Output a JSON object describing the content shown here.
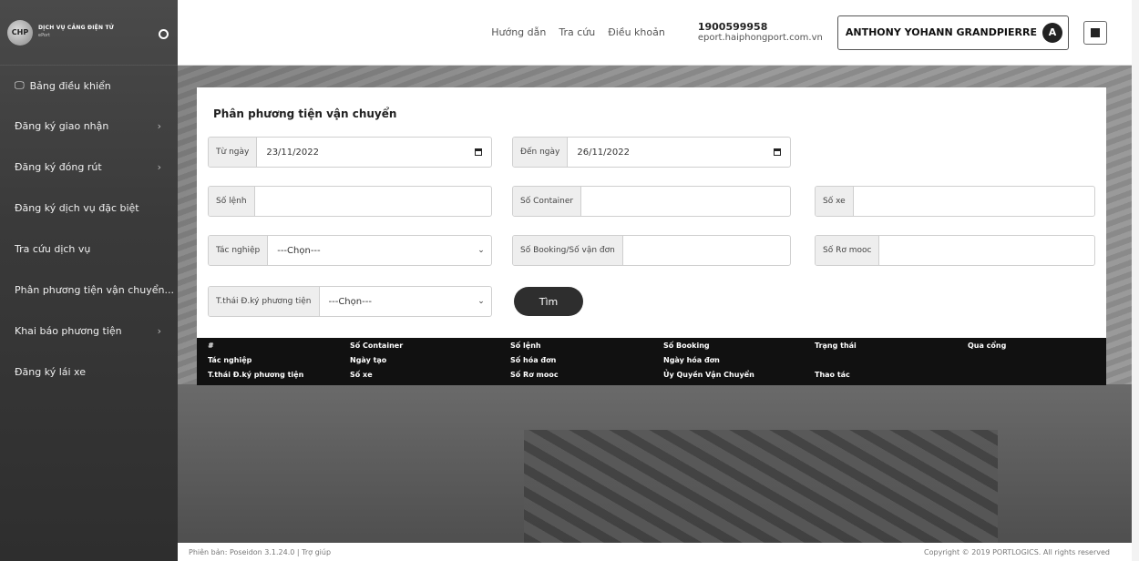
{
  "brand": {
    "logo_text": "CHP",
    "title": "DỊCH VỤ CẢNG ĐIỆN TỬ",
    "subtitle": "ePort"
  },
  "sidebar": {
    "items": [
      {
        "label": "Bảng điều khiển",
        "icon": "monitor-icon"
      },
      {
        "label": "Đăng ký giao nhận",
        "has_submenu": true
      },
      {
        "label": "Đăng ký đóng rút",
        "has_submenu": true
      },
      {
        "label": "Đăng ký dịch vụ đặc biệt"
      },
      {
        "label": "Tra cứu dịch vụ"
      },
      {
        "label": "Phân phương tiện vận chuyển..."
      },
      {
        "label": "Khai báo phương tiện",
        "has_submenu": true
      },
      {
        "label": "Đăng ký lái xe"
      }
    ],
    "chevron": "›"
  },
  "header": {
    "links": [
      "Hướng dẫn",
      "Tra cứu",
      "Điều khoản"
    ],
    "hotline": "1900599958",
    "email": "eport.haiphongport.com.vn",
    "user_name": "ANTHONY YOHANN GRANDPIERRE",
    "avatar_letter": "A"
  },
  "form": {
    "title": "Phân phương tiện vận chuyển",
    "from_date": {
      "label": "Từ ngày",
      "value": "23/11/2022"
    },
    "to_date": {
      "label": "Đến ngày",
      "value": "26/11/2022"
    },
    "order_no": {
      "label": "Số lệnh",
      "value": ""
    },
    "container_no": {
      "label": "Số Container",
      "value": ""
    },
    "vehicle_no": {
      "label": "Số xe",
      "value": ""
    },
    "operation": {
      "label": "Tác nghiệp",
      "value": "---Chọn---"
    },
    "booking_no": {
      "label": "Số Booking/Số vận đơn",
      "value": ""
    },
    "trailer_no": {
      "label": "Số Rơ mooc",
      "value": ""
    },
    "reg_status": {
      "label": "T.thái Đ.ký phương tiện",
      "value": "---Chọn---"
    },
    "search_label": "Tìm"
  },
  "table": {
    "headers": [
      {
        "label": "#"
      },
      {
        "label": "Số Container"
      },
      {
        "label": "Số lệnh"
      },
      {
        "label": "Số Booking"
      },
      {
        "label": "Trạng thái"
      },
      {
        "label": "Qua cổng"
      },
      {
        "label": "Tác nghiệp"
      },
      {
        "label": "Ngày tạo"
      },
      {
        "label": "Số hóa đơn"
      },
      {
        "label": "Ngày hóa đơn"
      },
      {
        "label": "T.thái Đ.ký phương tiện"
      },
      {
        "label": "Số xe"
      },
      {
        "label": "Số Rơ mooc"
      },
      {
        "label": "Ủy Quyền Vận Chuyển"
      },
      {
        "label": "Thao tác"
      }
    ]
  },
  "footer": {
    "version": "Phiên bản: Poseidon 3.1.24.0 | Trợ giúp",
    "copyright": "Copyright © 2019 PORTLOGICS. All rights reserved"
  }
}
